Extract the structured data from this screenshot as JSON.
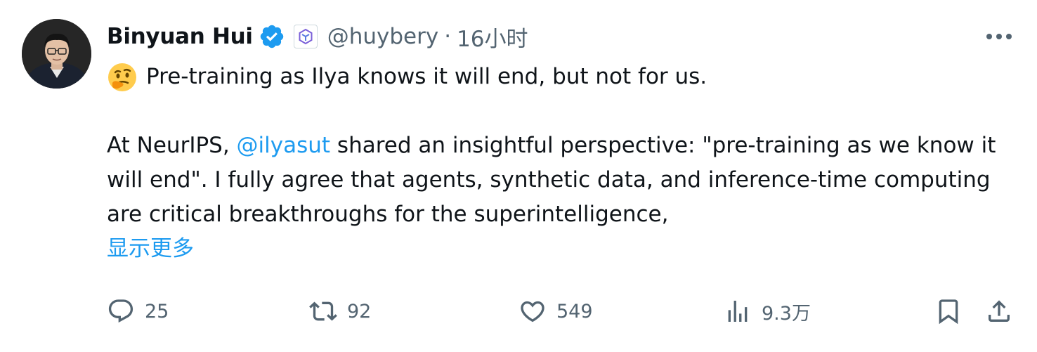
{
  "post": {
    "display_name": "Binyuan Hui",
    "handle": "@huybery",
    "separator": "·",
    "time": "16小时",
    "verified_color": "#1d9bf0",
    "text": {
      "line1": "Pre-training as Ilya knows it will end, but not for us.",
      "para2_prefix": "At NeurIPS, ",
      "mention": "@ilyasut",
      "para2_rest": "  shared an insightful perspective: \"pre-training as we know it will end\". I fully agree that agents, synthetic data, and inference-time computing are critical breakthroughs for the superintelligence,",
      "show_more": "显示更多"
    }
  },
  "actions": {
    "reply_count": "25",
    "retweet_count": "92",
    "like_count": "549",
    "views_count": "9.3万"
  },
  "icons": {
    "more": "more-dots-icon",
    "reply": "reply-bubble-icon",
    "retweet": "retweet-icon",
    "like": "heart-icon",
    "views": "bar-chart-icon",
    "bookmark": "bookmark-icon",
    "share": "share-upload-icon",
    "emoji": "thinking-face-emoji",
    "affiliation": "affiliation-badge-icon"
  },
  "colors": {
    "text": "#0f1419",
    "secondary": "#536471",
    "accent": "#1d9bf0"
  }
}
